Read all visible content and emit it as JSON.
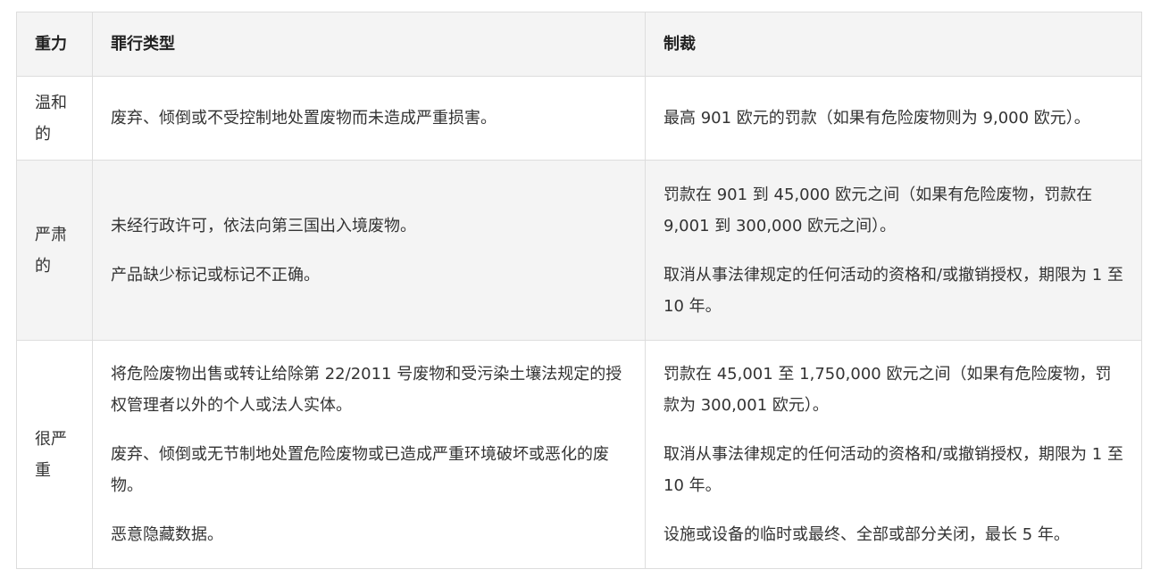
{
  "table": {
    "headers": {
      "severity": "重力",
      "offense": "罪行类型",
      "sanction": "制裁"
    },
    "rows": [
      {
        "severity": "温和的",
        "offenses": [
          "废弃、倾倒或不受控制地处置废物而未造成严重损害。"
        ],
        "sanctions": [
          "最高 901 欧元的罚款（如果有危险废物则为 9,000 欧元）。"
        ]
      },
      {
        "severity": "严肃的",
        "offenses": [
          "未经行政许可，依法向第三国出入境废物。",
          "产品缺少标记或标记不正确。"
        ],
        "sanctions": [
          "罚款在 901 到 45,000 欧元之间（如果有危险废物，罚款在 9,001 到 300,000 欧元之间）。",
          "取消从事法律规定的任何活动的资格和/或撤销授权，期限为 1 至 10 年。"
        ]
      },
      {
        "severity": "很严重",
        "offenses": [
          "将危险废物出售或转让给除第 22/2011 号废物和受污染土壤法规定的授权管理者以外的个人或法人实体。",
          "废弃、倾倒或无节制地处置危险废物或已造成严重环境破坏或恶化的废物。",
          "恶意隐藏数据。"
        ],
        "sanctions": [
          "罚款在 45,001 至 1,750,000 欧元之间（如果有危险废物，罚款为 300,001 欧元）。",
          "取消从事法律规定的任何活动的资格和/或撤销授权，期限为 1 至 10 年。",
          "设施或设备的临时或最终、全部或部分关闭，最长 5 年。"
        ]
      }
    ]
  }
}
